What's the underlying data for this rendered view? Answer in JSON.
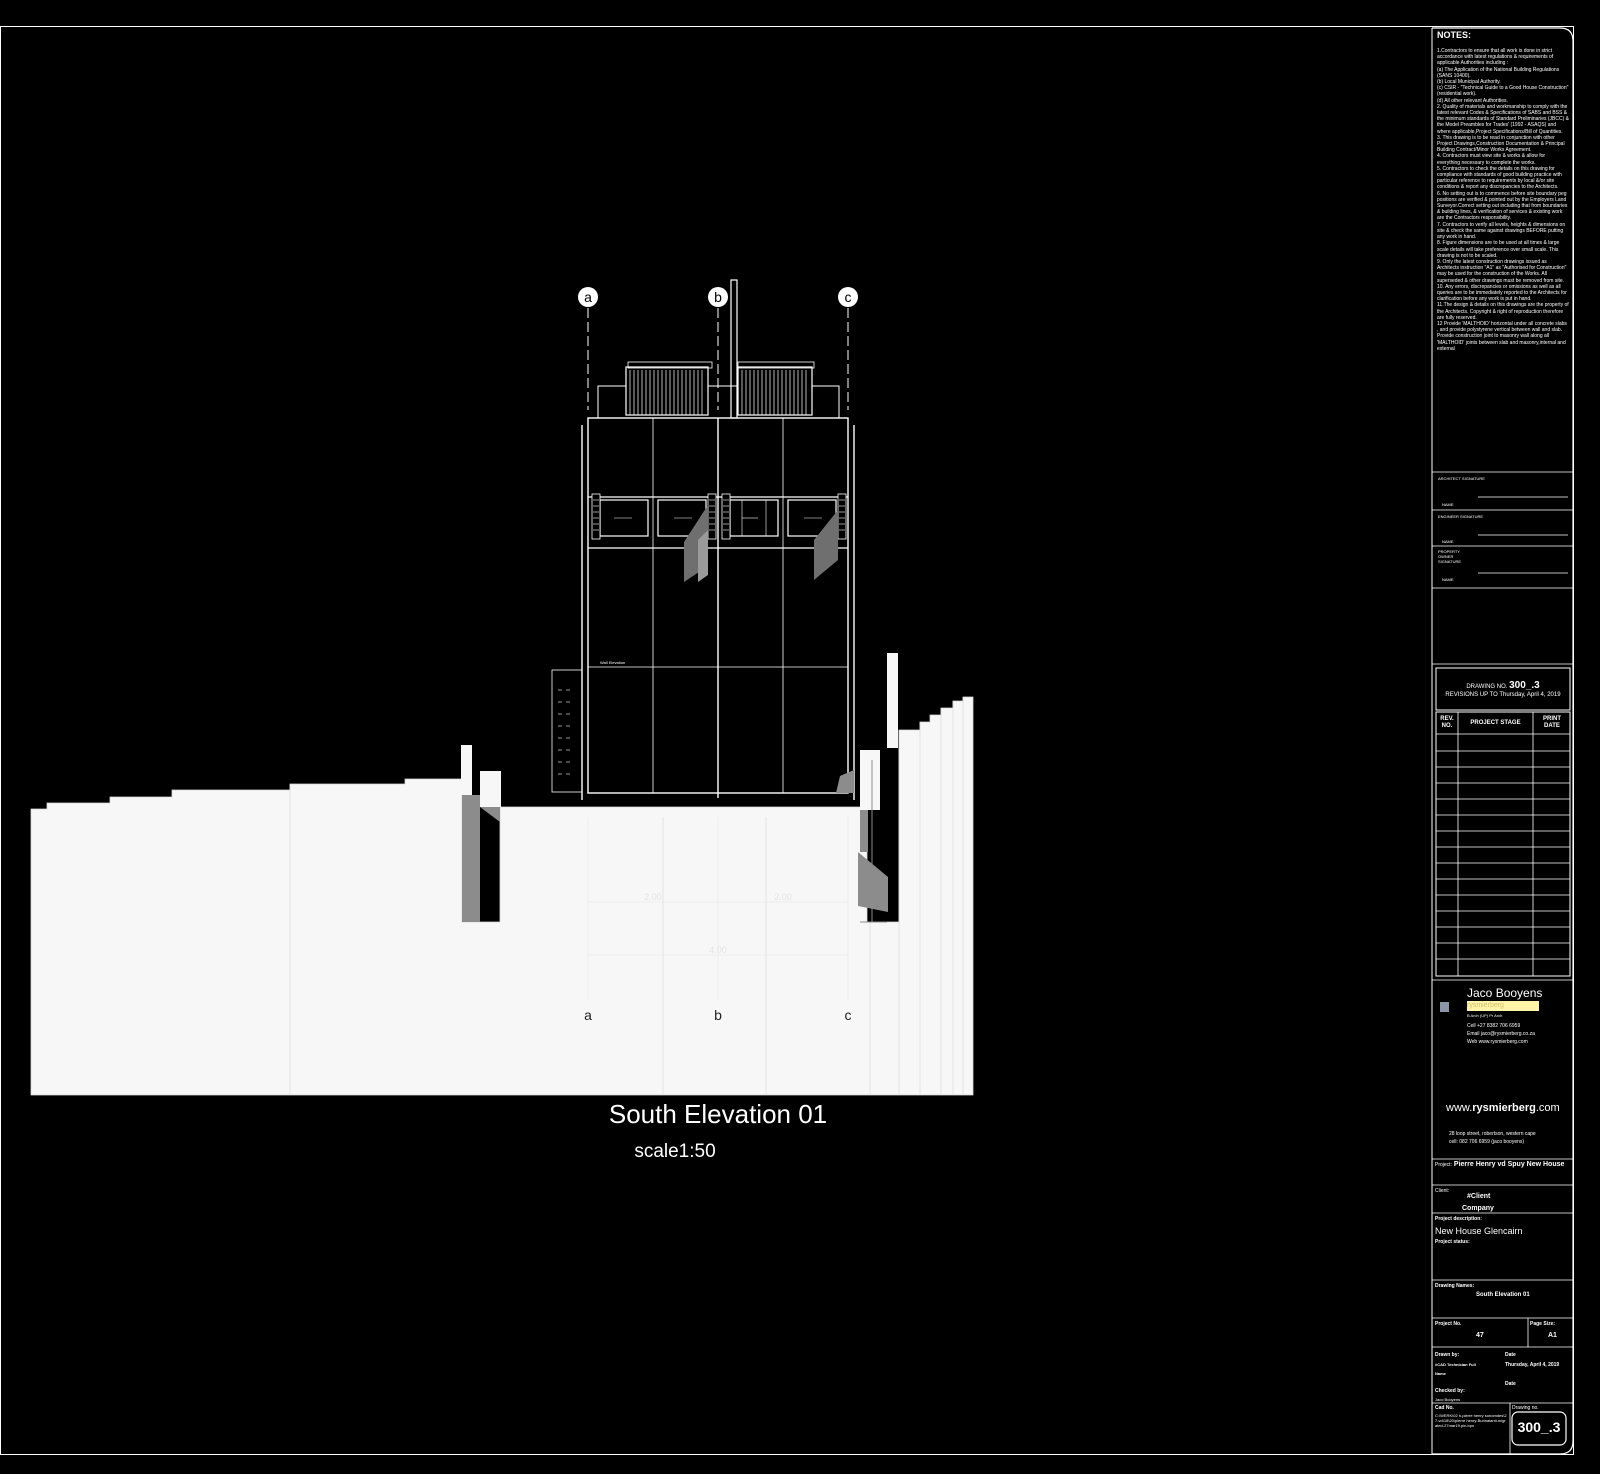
{
  "drawing": {
    "title": "South Elevation 01",
    "scale": "scale1:50",
    "gridlines": [
      "a",
      "b",
      "c"
    ],
    "dimensions": [
      "2.00",
      "2.00",
      "4.00"
    ],
    "level_label": "Wall Elevation"
  },
  "title_block": {
    "notes_heading": "NOTES:",
    "notes": [
      "1.Contractors to ensure that all work is done in strict accordance with latest regulations & requirements of applicable Authorities including :",
      "(a) The Application of the National Building Regulations (SANS 10400).",
      "(b) Local Municipal Authority.",
      "(c) CSIR - \"Technical Guide to a Good House Construction\" (residential work).",
      "(d) All other relevant Authorities.",
      "2. Quality of materials and workmanship to comply with the latest relevant Codes & Specifications of SABS and BSS & the minimum standards of Standard Preliminaries (JBCC) & the Model Preambles for Trades' (1992 - ASAQS) and where applicable,Project Specifications/Bill of Quantities.",
      "3. This drawing is to be read in conjunction with other Project Drawings,Construction Documentation & Principal Building Contract/Minor Works Agreement.",
      "4. Contractors must view site & works & allow for everything necessary to complete the works.",
      "5. Contractors to check the details on this drawing for compliance with standards of good building practice with particular reference to requirements by local &/or site conditions & report any discrepancies to the Architects.",
      "6. No setting out is to commence before site boundary peg positions are verified & pointed out by the Employers Land Surveyor.Correct setting out including that from boundaries & building lines, & verification of services & existing work are the Contractors responsibility.",
      "7. Contractors to verify all levels, heights & dimensions on site & check the same against drawings BEFORE putting any work in hand.",
      "8. Figure dimensions are to be used at all times & large scale details will take preference over small scale. This drawing is not to be scaled.",
      "9. Only the latest construction drawings issued as Architects instruction \"A1\" as \"Authorised for Construction\" may be used for the construction of the Works. All superseded & other drawings must be removed from site.",
      "10. Any errors, discrepancies or omissions as well as all queries are to be immediately reported to the Architects for clarification before any work is put in hand.",
      "11.The design & details on this drawings are the property of the Architects. Copyright & right of reproduction therefore are fully reserved.",
      "12 Provide 'MALTHOID' horizontal under all concrete slabs , and provide polystyrene vertical between wall and slab. Provide construction joint to masonry wall along all 'MALTHOID' joints between slab and masonry,internal and external"
    ],
    "signatures": [
      {
        "role": "ARCHITECT SIGNATURE",
        "name_label": "NAME"
      },
      {
        "role": "ENGINEER SIGNATURE",
        "name_label": "NAME"
      },
      {
        "role": "PROPERTY OWNER SIGNATURE",
        "name_label": "NAME"
      }
    ],
    "drawing_no_label": "DRAWING NO.",
    "drawing_no": "300_.3",
    "revisions_label": "REVISIONS UP TO Thursday, April 4, 2019",
    "rev_headers": [
      "REV. NO.",
      "PROJECT STAGE",
      "PRINT DATE"
    ],
    "firm_name_1": "Jaco",
    "firm_name_2": "Booyens",
    "firm_highlight": "rysmierberg",
    "firm_credentials": "B Arch (UP) Pr Arch",
    "contact": [
      "Cell +27 8382 706 6959",
      "Email jaco@rysmierberg.co.za",
      "Web www.rysmierberg.com"
    ],
    "website_prefix": "www.",
    "website_bold": "rysmierberg",
    "website_suffix": ".com",
    "address_1": "28 loop street, robertson, western cape",
    "address_2": "cell: 082 706 6959  (jaco booyens)",
    "project_label": "Project:",
    "project_value": "Pierre Henry vd Spuy New House",
    "client_label": "Client:",
    "client_value_1": "#Client",
    "client_value_2": "Company",
    "description_label": "Project description:",
    "description_value": "New House Glencairn",
    "status_label": "Project status:",
    "drawing_names_label": "Drawing Names:",
    "drawing_names_value": "South Elevation 01",
    "project_no_label": "Project No.",
    "project_no_value": "47",
    "page_size_label": "Page Size:",
    "page_size_value": "A1",
    "drawn_by_label": "Drawn by:",
    "drawn_by_value_1": "#CAD Technician Full",
    "drawn_by_value_2": "Name",
    "date_label": "Date",
    "date_value": "Thursday, April 4, 2019",
    "checked_by_label": "Checked by:",
    "checked_by_value": "Jaco Booyens",
    "date_label_2": "Date",
    "cad_no_label": "Cad No.",
    "cad_no_value": "C:\\WERK\\02 h-pierre henry sonomdes\\27-vd\\18\\20\\pierre henry-Burinalanti-migrated-27mar19.pln.bpn",
    "drawing_no_label_2": "Drawing no.",
    "drawing_no_big": "300_.3"
  },
  "colors": {
    "background": "#000000",
    "line": "#ffffff",
    "ground_fill": "#f7f7f7",
    "shadow": "#8c8c8c",
    "firm_highlight_bg": "#fff4a8"
  }
}
